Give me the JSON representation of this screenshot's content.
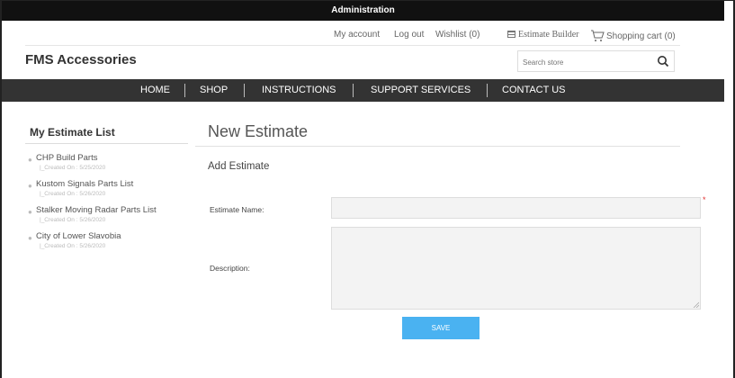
{
  "admin_bar": {
    "label": "Administration"
  },
  "header_links": {
    "my_account": "My account",
    "log_out": "Log out",
    "wishlist": "Wishlist (0)",
    "estimate_builder": "Estimate Builder",
    "shopping_cart": "Shopping cart (0)"
  },
  "store": {
    "name": "FMS Accessories"
  },
  "search": {
    "placeholder": "Search store"
  },
  "nav": {
    "items": [
      {
        "label": "HOME"
      },
      {
        "label": "SHOP"
      },
      {
        "label": "INSTRUCTIONS"
      },
      {
        "label": "SUPPORT SERVICES"
      },
      {
        "label": "CONTACT US"
      }
    ]
  },
  "sidebar": {
    "title": "My Estimate List",
    "estimates": [
      {
        "name": "CHP Build Parts",
        "created": "|_Created On : 5/25/2020"
      },
      {
        "name": "Kustom Signals Parts List",
        "created": "|_Created On : 5/26/2020"
      },
      {
        "name": "Stalker Moving Radar Parts List",
        "created": "|_Created On : 5/26/2020"
      },
      {
        "name": "City of Lower Slavobia",
        "created": "|_Created On : 5/26/2020"
      }
    ]
  },
  "main": {
    "title": "New Estimate",
    "section_title": "Add Estimate",
    "form": {
      "name_label": "Estimate Name:",
      "name_value": "",
      "required_mark": "*",
      "description_label": "Description:",
      "description_value": "",
      "save_label": "SAVE"
    }
  },
  "colors": {
    "admin_bar": "#111111",
    "nav_bar": "#333333",
    "save_button": "#4ab2f1",
    "required": "#e03030",
    "input_bg": "#f3f3f3"
  }
}
